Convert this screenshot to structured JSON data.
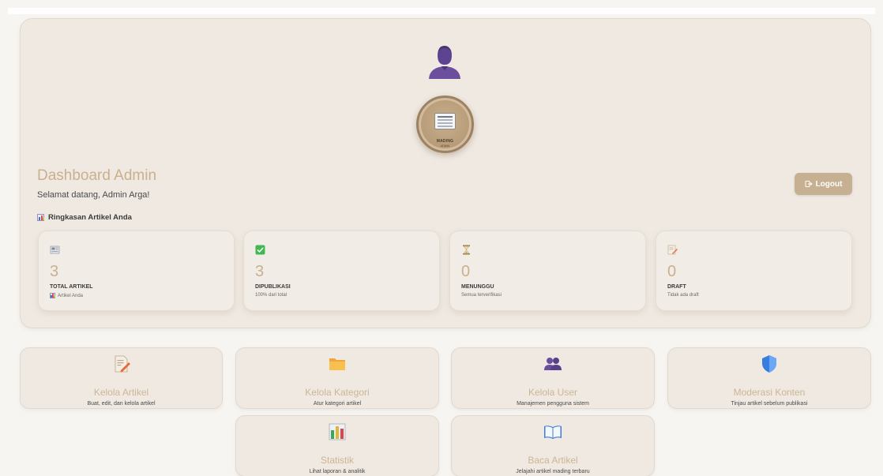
{
  "header": {
    "logo_text": "MADING",
    "logo_subtext": "ADMIN",
    "title": "Dashboard Admin",
    "welcome": "Selamat datang, Admin Arga!",
    "summary_title": "Ringkasan Artikel Anda",
    "logout_label": "Logout",
    "logout_icon": "logout-icon"
  },
  "stats": [
    {
      "icon": "newspaper-icon",
      "value": "3",
      "label": "TOTAL ARTIKEL",
      "sub": "Artikel Anda",
      "sub_icon": "bar-chart-icon"
    },
    {
      "icon": "check-box-icon",
      "value": "3",
      "label": "DIPUBLIKASI",
      "sub": "100% dari total"
    },
    {
      "icon": "hourglass-icon",
      "value": "0",
      "label": "MENUNGGU",
      "sub": "Semua terverifikasi"
    },
    {
      "icon": "memo-icon",
      "value": "0",
      "label": "DRAFT",
      "sub": "Tidak ada draft"
    }
  ],
  "menu": [
    {
      "icon": "edit-document-icon",
      "title": "Kelola Artikel",
      "desc": "Buat, edit, dan kelola artikel"
    },
    {
      "icon": "folder-icon",
      "title": "Kelola Kategori",
      "desc": "Atur kategori artikel"
    },
    {
      "icon": "users-icon",
      "title": "Kelola User",
      "desc": "Manajemen pengguna sistem"
    },
    {
      "icon": "shield-icon",
      "title": "Moderasi Konten",
      "desc": "Tinjau artikel sebelum publikasi"
    },
    {
      "icon": "statistics-chart-icon",
      "title": "Statistik",
      "desc": "Lihat laporan & analitik"
    },
    {
      "icon": "open-book-icon",
      "title": "Baca Artikel",
      "desc": "Jelajahi artikel mading terbaru"
    }
  ],
  "colors": {
    "accent": "#c9b08e",
    "card_bg": "#efe9e2",
    "avatar": "#6b4f9c"
  }
}
